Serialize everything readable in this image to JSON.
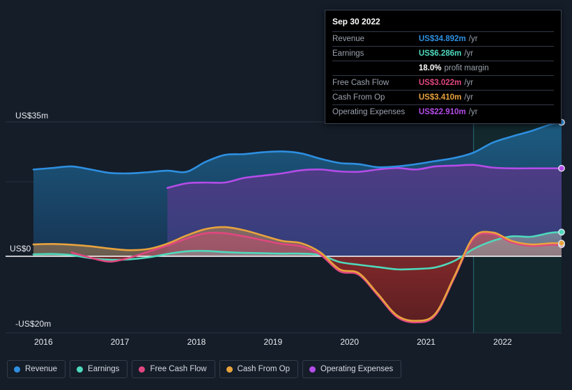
{
  "theme": {
    "background": "#151d29",
    "zero_line": "#ffffff",
    "grid": "#2b3442",
    "text": "#e8eaee",
    "muted": "#9aa2ae"
  },
  "tooltip": {
    "date": "Sep 30 2022",
    "rows": [
      {
        "label": "Revenue",
        "value": "US$34.892m",
        "unit": "/yr",
        "color": "#2e8fe0"
      },
      {
        "label": "Earnings",
        "value": "US$6.286m",
        "unit": "/yr",
        "color": "#4ed9bc"
      },
      {
        "label": "",
        "value": "18.0%",
        "unit": "profit margin",
        "color": "#ffffff"
      },
      {
        "label": "Free Cash Flow",
        "value": "US$3.022m",
        "unit": "/yr",
        "color": "#e0477f"
      },
      {
        "label": "Cash From Op",
        "value": "US$3.410m",
        "unit": "/yr",
        "color": "#e8a33d"
      },
      {
        "label": "Operating Expenses",
        "value": "US$22.910m",
        "unit": "/yr",
        "color": "#b44ce8"
      }
    ]
  },
  "legend": {
    "items": [
      {
        "label": "Revenue",
        "color": "#2e8fe0"
      },
      {
        "label": "Earnings",
        "color": "#4ed9bc"
      },
      {
        "label": "Free Cash Flow",
        "color": "#e0477f"
      },
      {
        "label": "Cash From Op",
        "color": "#e8a33d"
      },
      {
        "label": "Operating Expenses",
        "color": "#b44ce8"
      }
    ]
  },
  "chart_data": {
    "type": "area",
    "title": "",
    "xlabel": "",
    "ylabel": "",
    "currency": "US$",
    "unit": "m",
    "ylim": [
      -20,
      35
    ],
    "y_ticks": [
      35,
      0,
      -20
    ],
    "y_tick_labels": [
      "US$35m",
      "US$0",
      "-US$20m"
    ],
    "grid": true,
    "legend_position": "bottom-left",
    "x_tick_labels": [
      "2016",
      "2017",
      "2018",
      "2019",
      "2020",
      "2021",
      "2022"
    ],
    "x_ticks": [
      2016,
      2017,
      2018,
      2019,
      2020,
      2021,
      2022
    ],
    "xlim": [
      2015.87,
      2022.77
    ],
    "highlight_band": {
      "from": 2021.62,
      "to": 2022.77,
      "label": ""
    },
    "series": [
      {
        "name": "Revenue",
        "color": "#2e8fe0",
        "x": [
          2015.87,
          2016.12,
          2016.37,
          2016.62,
          2016.87,
          2017.12,
          2017.37,
          2017.62,
          2017.87,
          2018.12,
          2018.37,
          2018.62,
          2018.87,
          2019.12,
          2019.37,
          2019.62,
          2019.87,
          2020.12,
          2020.37,
          2020.62,
          2020.87,
          2021.12,
          2021.37,
          2021.62,
          2021.87,
          2022.12,
          2022.37,
          2022.62,
          2022.77
        ],
        "values": [
          22.6,
          23.0,
          23.4,
          22.6,
          21.7,
          21.6,
          21.9,
          22.3,
          22.0,
          24.6,
          26.4,
          26.6,
          27.1,
          27.3,
          26.8,
          25.4,
          24.3,
          24.0,
          23.2,
          23.4,
          24.0,
          24.8,
          25.6,
          27.0,
          29.6,
          31.2,
          32.6,
          34.3,
          34.892
        ]
      },
      {
        "name": "Operating Expenses",
        "color": "#b44ce8",
        "x": [
          2017.62,
          2017.87,
          2018.12,
          2018.37,
          2018.62,
          2018.87,
          2019.12,
          2019.37,
          2019.62,
          2019.87,
          2020.12,
          2020.37,
          2020.62,
          2020.87,
          2021.12,
          2021.37,
          2021.62,
          2021.87,
          2022.12,
          2022.37,
          2022.62,
          2022.77
        ],
        "values": [
          17.8,
          19.0,
          19.2,
          19.2,
          20.4,
          21.0,
          21.6,
          22.4,
          22.6,
          22.1,
          22.0,
          22.6,
          23.0,
          22.6,
          23.4,
          23.6,
          23.8,
          23.1,
          22.9,
          22.9,
          22.9,
          22.91
        ]
      },
      {
        "name": "Cash From Op",
        "color": "#e8a33d",
        "x": [
          2015.87,
          2016.12,
          2016.37,
          2016.62,
          2016.87,
          2017.12,
          2017.37,
          2017.62,
          2017.87,
          2018.12,
          2018.37,
          2018.62,
          2018.87,
          2019.12,
          2019.37,
          2019.62,
          2019.87,
          2020.12,
          2020.37,
          2020.62,
          2020.87,
          2021.12,
          2021.37,
          2021.62,
          2021.87,
          2022.12,
          2022.37,
          2022.62,
          2022.77
        ],
        "values": [
          3.1,
          3.2,
          3.0,
          2.6,
          2.0,
          1.6,
          1.9,
          3.3,
          5.4,
          7.1,
          7.6,
          6.8,
          5.4,
          4.0,
          3.4,
          1.0,
          -3.4,
          -4.4,
          -9.8,
          -15.4,
          -16.8,
          -15.0,
          -5.2,
          5.0,
          6.2,
          4.0,
          3.1,
          3.4,
          3.41
        ]
      },
      {
        "name": "Free Cash Flow",
        "color": "#e0477f",
        "x": [
          2016.37,
          2016.62,
          2016.87,
          2017.12,
          2017.37,
          2017.62,
          2017.87,
          2018.12,
          2018.37,
          2018.62,
          2018.87,
          2019.12,
          2019.37,
          2019.62,
          2019.87,
          2020.12,
          2020.37,
          2020.62,
          2020.87,
          2021.12,
          2021.37,
          2021.62,
          2021.87,
          2022.12,
          2022.37,
          2022.62,
          2022.77
        ],
        "values": [
          1.0,
          -0.4,
          -1.4,
          -0.4,
          1.2,
          2.8,
          4.6,
          6.0,
          6.0,
          5.2,
          4.2,
          3.2,
          2.6,
          0.4,
          -3.9,
          -4.8,
          -10.2,
          -15.8,
          -17.2,
          -15.4,
          -5.6,
          4.6,
          5.8,
          3.6,
          2.7,
          3.0,
          3.022
        ]
      },
      {
        "name": "Earnings",
        "color": "#4ed9bc",
        "x": [
          2015.87,
          2016.12,
          2016.37,
          2016.62,
          2016.87,
          2017.12,
          2017.37,
          2017.62,
          2017.87,
          2018.12,
          2018.37,
          2018.62,
          2018.87,
          2019.12,
          2019.37,
          2019.62,
          2019.87,
          2020.12,
          2020.37,
          2020.62,
          2020.87,
          2021.12,
          2021.37,
          2021.62,
          2021.87,
          2022.12,
          2022.37,
          2022.62,
          2022.77
        ],
        "values": [
          0.5,
          0.6,
          0.3,
          -0.5,
          -0.9,
          -0.8,
          -0.3,
          0.6,
          1.3,
          1.4,
          1.1,
          0.9,
          0.8,
          0.7,
          0.7,
          0.3,
          -1.5,
          -2.2,
          -2.8,
          -3.4,
          -3.3,
          -2.9,
          -1.2,
          1.9,
          4.0,
          5.2,
          5.1,
          6.1,
          6.286
        ]
      }
    ]
  }
}
